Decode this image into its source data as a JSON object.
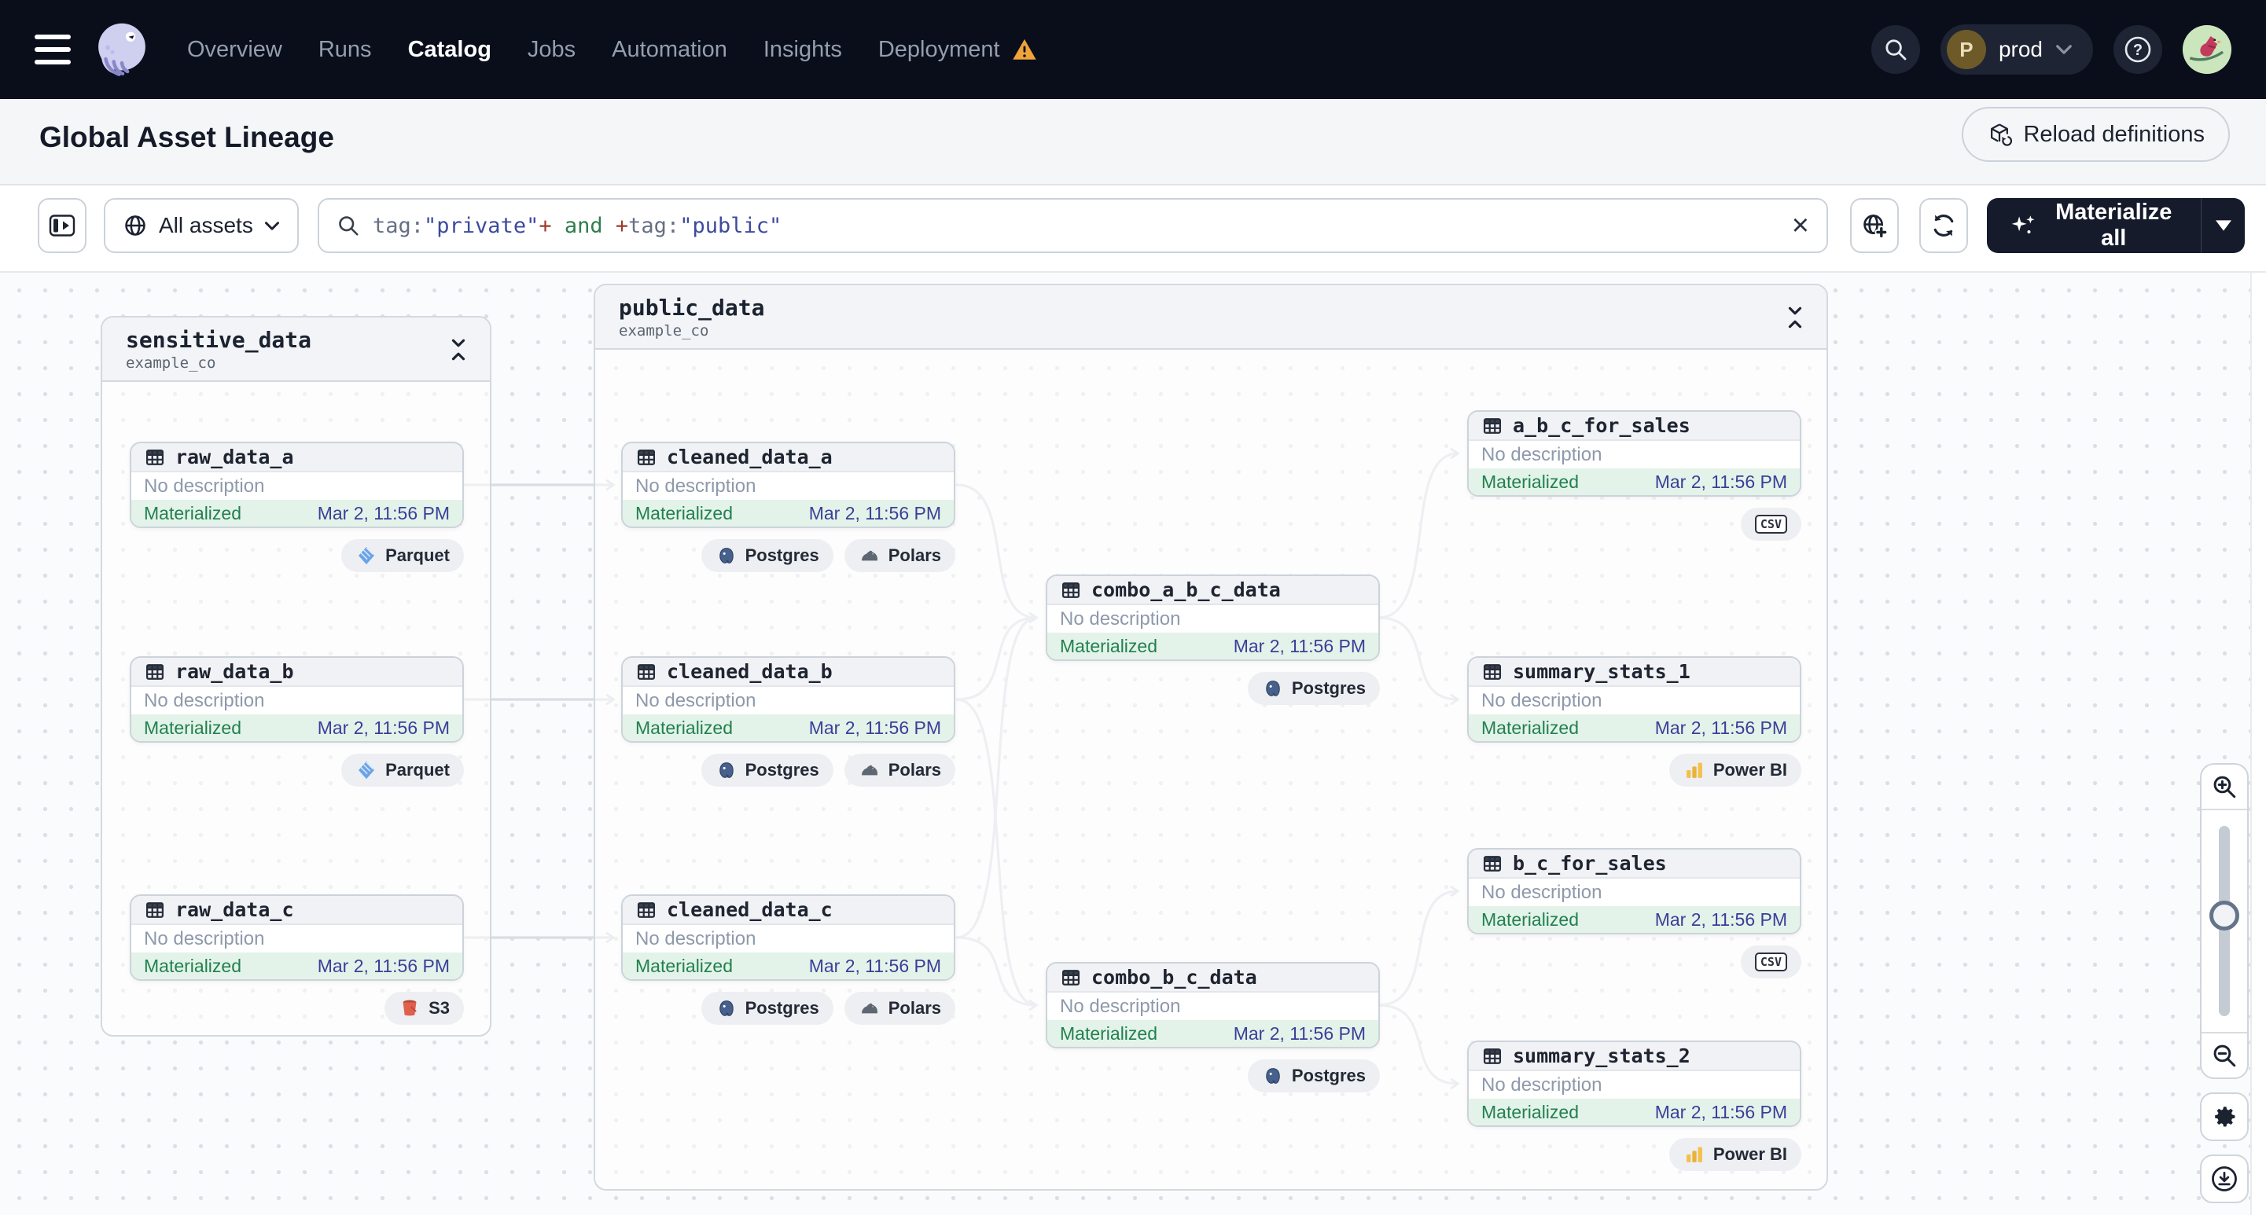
{
  "nav": {
    "items": [
      "Overview",
      "Runs",
      "Catalog",
      "Jobs",
      "Automation",
      "Insights",
      "Deployment"
    ],
    "active_item": "Catalog",
    "environment": {
      "initial": "P",
      "name": "prod"
    }
  },
  "header": {
    "title": "Global Asset Lineage",
    "reload_label": "Reload definitions"
  },
  "toolbar": {
    "scope_label": "All assets",
    "search_tokens": {
      "t0": "tag:",
      "t1": "\"private\"",
      "t2": "+",
      "t3": " and ",
      "t4": "+",
      "t5": "tag:",
      "t6": "\"public\""
    },
    "materialize_label": "Materialize all"
  },
  "colors": {
    "nav_bg": "#0a0e1b",
    "token_field": "#667084",
    "token_string": "#3d4a9e",
    "token_plus": "#9e3b2f",
    "token_keyword": "#2f7d4f",
    "status_green": "#22804f",
    "status_bg": "#e3f3e9",
    "timestamp_indigo": "#3a3f99",
    "warning_orange": "#efa43a",
    "materialize_bg": "#151b2b"
  },
  "graph": {
    "groups": [
      {
        "name": "sensitive_data",
        "location": "example_co"
      },
      {
        "name": "public_data",
        "location": "example_co"
      }
    ],
    "nodes": [
      {
        "name": "raw_data_a",
        "description": "No description",
        "status": "Materialized",
        "timestamp": "Mar 2, 11:56 PM",
        "badges": [
          {
            "icon": "parquet",
            "label": "Parquet"
          }
        ]
      },
      {
        "name": "raw_data_b",
        "description": "No description",
        "status": "Materialized",
        "timestamp": "Mar 2, 11:56 PM",
        "badges": [
          {
            "icon": "parquet",
            "label": "Parquet"
          }
        ]
      },
      {
        "name": "raw_data_c",
        "description": "No description",
        "status": "Materialized",
        "timestamp": "Mar 2, 11:56 PM",
        "badges": [
          {
            "icon": "s3",
            "label": "S3"
          }
        ]
      },
      {
        "name": "cleaned_data_a",
        "description": "No description",
        "status": "Materialized",
        "timestamp": "Mar 2, 11:56 PM",
        "badges": [
          {
            "icon": "postgres",
            "label": "Postgres"
          },
          {
            "icon": "polars",
            "label": "Polars"
          }
        ]
      },
      {
        "name": "cleaned_data_b",
        "description": "No description",
        "status": "Materialized",
        "timestamp": "Mar 2, 11:56 PM",
        "badges": [
          {
            "icon": "postgres",
            "label": "Postgres"
          },
          {
            "icon": "polars",
            "label": "Polars"
          }
        ]
      },
      {
        "name": "cleaned_data_c",
        "description": "No description",
        "status": "Materialized",
        "timestamp": "Mar 2, 11:56 PM",
        "badges": [
          {
            "icon": "postgres",
            "label": "Postgres"
          },
          {
            "icon": "polars",
            "label": "Polars"
          }
        ]
      },
      {
        "name": "combo_a_b_c_data",
        "description": "No description",
        "status": "Materialized",
        "timestamp": "Mar 2, 11:56 PM",
        "badges": [
          {
            "icon": "postgres",
            "label": "Postgres"
          }
        ]
      },
      {
        "name": "combo_b_c_data",
        "description": "No description",
        "status": "Materialized",
        "timestamp": "Mar 2, 11:56 PM",
        "badges": [
          {
            "icon": "postgres",
            "label": "Postgres"
          }
        ]
      },
      {
        "name": "a_b_c_for_sales",
        "description": "No description",
        "status": "Materialized",
        "timestamp": "Mar 2, 11:56 PM",
        "badges": [
          {
            "icon": "csv",
            "label": "CSV"
          }
        ]
      },
      {
        "name": "summary_stats_1",
        "description": "No description",
        "status": "Materialized",
        "timestamp": "Mar 2, 11:56 PM",
        "badges": [
          {
            "icon": "powerbi",
            "label": "Power BI"
          }
        ]
      },
      {
        "name": "b_c_for_sales",
        "description": "No description",
        "status": "Materialized",
        "timestamp": "Mar 2, 11:56 PM",
        "badges": [
          {
            "icon": "csv",
            "label": "CSV"
          }
        ]
      },
      {
        "name": "summary_stats_2",
        "description": "No description",
        "status": "Materialized",
        "timestamp": "Mar 2, 11:56 PM",
        "badges": [
          {
            "icon": "powerbi",
            "label": "Power BI"
          }
        ]
      }
    ]
  }
}
